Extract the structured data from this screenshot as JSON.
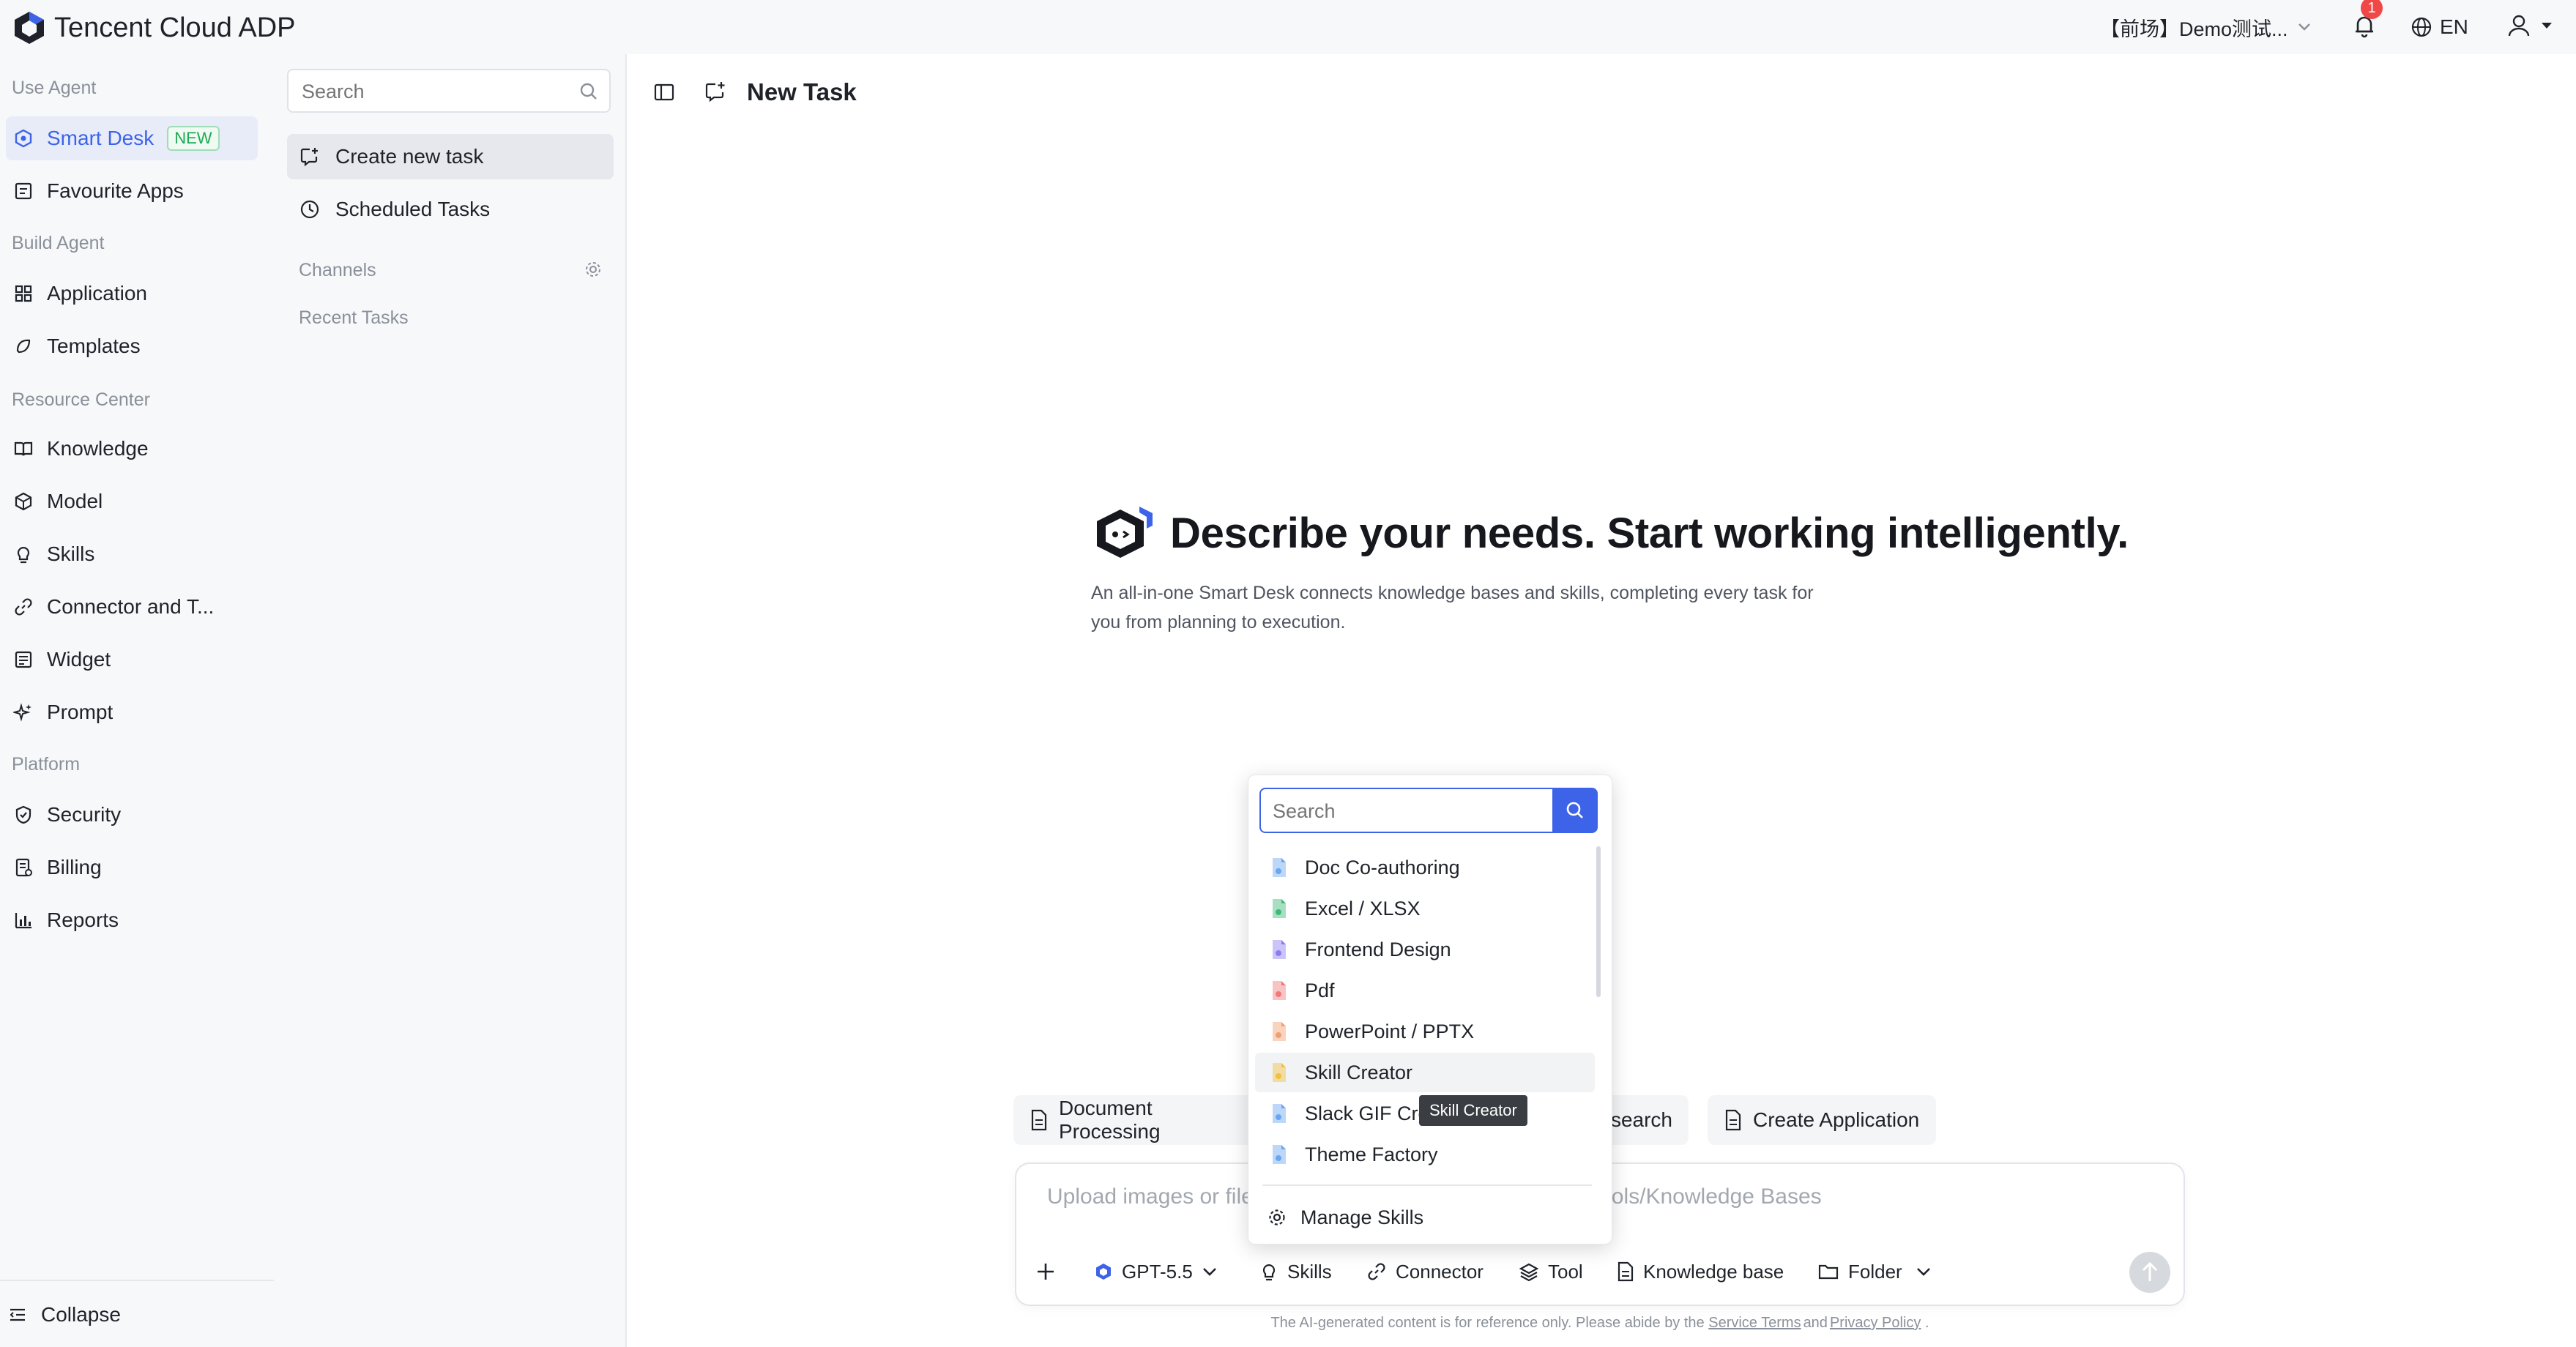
{
  "app": {
    "title": "Tencent Cloud ADP"
  },
  "topbar": {
    "workspace": "【前场】Demo测试...",
    "notification_count": "1",
    "language": "EN"
  },
  "nav": {
    "sections": {
      "use_agent": "Use Agent",
      "build_agent": "Build Agent",
      "resource_center": "Resource Center",
      "platform": "Platform"
    },
    "items": {
      "smart_desk": "Smart Desk",
      "smart_desk_badge": "NEW",
      "favourite_apps": "Favourite Apps",
      "application": "Application",
      "templates": "Templates",
      "knowledge": "Knowledge",
      "model": "Model",
      "skills": "Skills",
      "connector": "Connector and T...",
      "widget": "Widget",
      "prompt": "Prompt",
      "security": "Security",
      "billing": "Billing",
      "reports": "Reports"
    },
    "collapse": "Collapse"
  },
  "tasks_panel": {
    "search_placeholder": "Search",
    "create_new_task": "Create new task",
    "scheduled_tasks": "Scheduled Tasks",
    "channels": "Channels",
    "recent_tasks": "Recent Tasks"
  },
  "main": {
    "page_title": "New Task",
    "hero_title": "Describe your needs. Start working intelligently.",
    "hero_subtitle": "An all-in-one Smart Desk connects knowledge bases and skills, completing every task for you from planning to execution.",
    "chips": {
      "document_processing": "Document Processing",
      "research": "esearch",
      "create_application": "Create Application"
    },
    "composer": {
      "placeholder": "Upload images or files, or type @ to use installed Skills/Tools/Knowledge Bases",
      "model": "GPT-5.5",
      "skills": "Skills",
      "connector": "Connector",
      "tool": "Tool",
      "knowledge_base": "Knowledge base",
      "folder": "Folder"
    },
    "disclaimer_prefix": "The AI-generated content is for reference only. Please abide by the",
    "disclaimer_terms": "Service Terms",
    "disclaimer_and": "and",
    "disclaimer_privacy": "Privacy Policy",
    "disclaimer_suffix": "."
  },
  "skills_dropdown": {
    "search_placeholder": "Search",
    "items": [
      {
        "label": "Doc Co-authoring",
        "color": "#6aa7f0"
      },
      {
        "label": "Excel / XLSX",
        "color": "#3fb97b"
      },
      {
        "label": "Frontend Design",
        "color": "#8c7cf0"
      },
      {
        "label": "Pdf",
        "color": "#f07a7a"
      },
      {
        "label": "PowerPoint / PPTX",
        "color": "#f0a070"
      },
      {
        "label": "Skill Creator",
        "color": "#f0c040"
      },
      {
        "label": "Slack GIF Cre",
        "color": "#6aa7f0"
      },
      {
        "label": "Theme Factory",
        "color": "#6aa7f0"
      }
    ],
    "manage": "Manage Skills",
    "tooltip": "Skill Creator"
  },
  "colors": {
    "accent": "#3d64e8",
    "sidebar_bg": "#f7f8fa",
    "badge_red": "#f04747"
  }
}
